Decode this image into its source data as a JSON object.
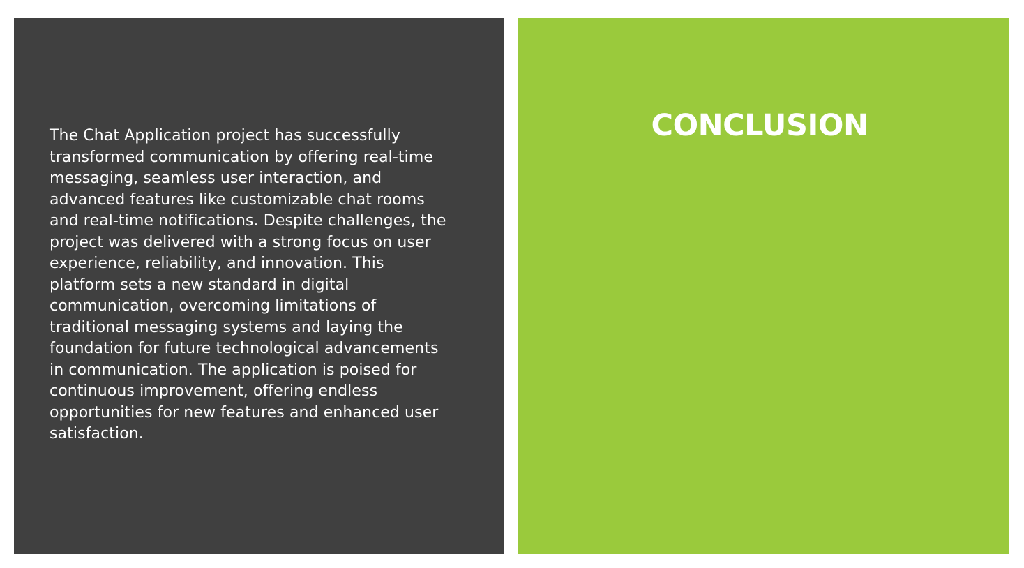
{
  "slide": {
    "title": "CONCLUSION",
    "body": "The Chat Application project has successfully transformed communication by offering real-time messaging, seamless user interaction, and advanced features like customizable chat rooms and real-time notifications. Despite challenges, the project was delivered with a strong focus on user experience, reliability, and innovation. This platform sets a new standard in digital communication, overcoming limitations of traditional messaging systems and laying the foundation for future technological advancements in communication. The application is poised for continuous improvement, offering endless opportunities for new features and enhanced user satisfaction."
  },
  "colors": {
    "left_panel": "#404040",
    "right_panel": "#9aca3c",
    "text": "#ffffff",
    "background": "#ffffff"
  }
}
